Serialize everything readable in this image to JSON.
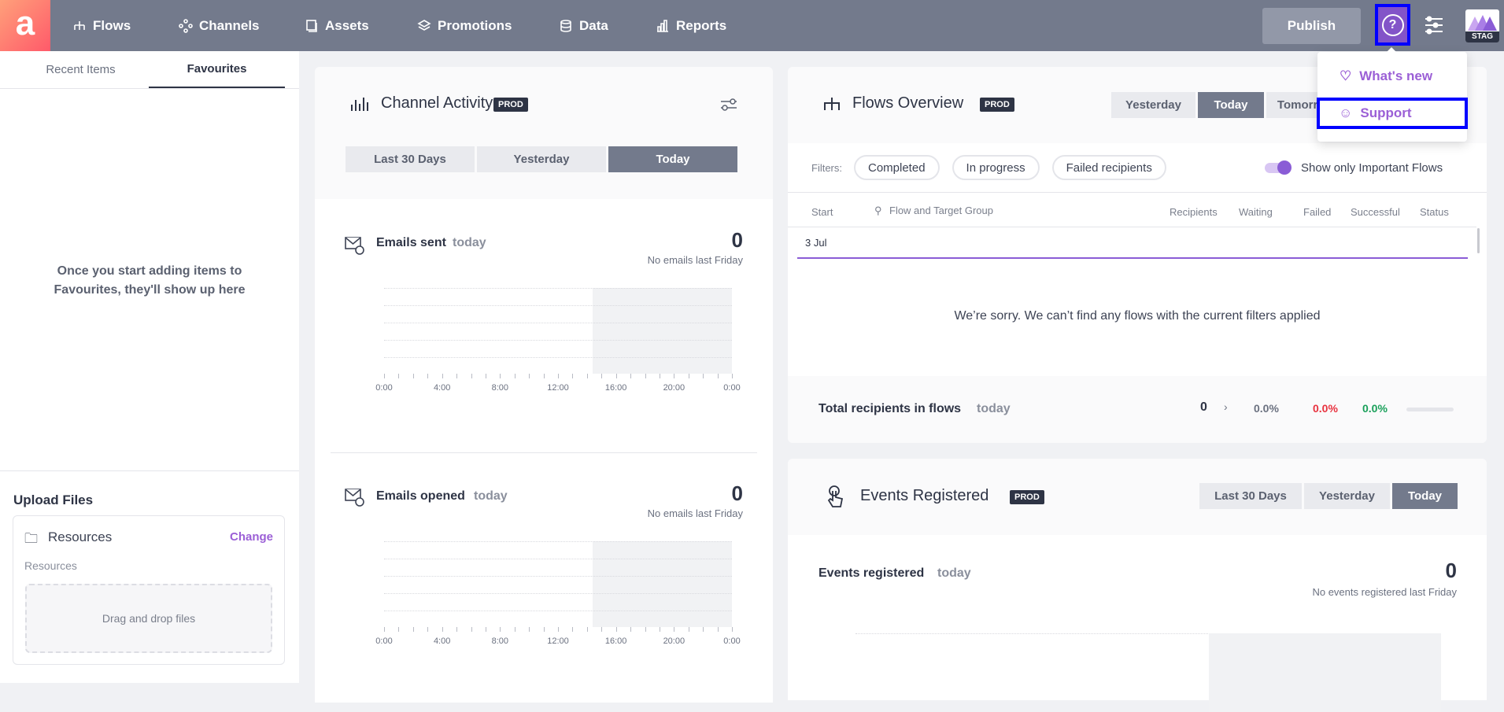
{
  "topbar": {
    "logo": "a",
    "nav": [
      {
        "label": "Flows",
        "icon": "flows-icon"
      },
      {
        "label": "Channels",
        "icon": "channels-icon"
      },
      {
        "label": "Assets",
        "icon": "assets-icon"
      },
      {
        "label": "Promotions",
        "icon": "promotions-icon"
      },
      {
        "label": "Data",
        "icon": "database-icon"
      },
      {
        "label": "Reports",
        "icon": "reports-icon"
      }
    ],
    "publish": "Publish",
    "help": "?",
    "env": "STAG"
  },
  "help_menu": {
    "items": [
      {
        "label": "What's new",
        "icon": "heart-icon"
      },
      {
        "label": "Support",
        "icon": "smiley-icon"
      }
    ]
  },
  "left": {
    "tabs": [
      "Recent Items",
      "Favourites"
    ],
    "active_tab": "Favourites",
    "empty": "Once you start adding items to Favourites, they'll show up here",
    "upload": {
      "title": "Upload Files",
      "folder": "Resources",
      "change": "Change",
      "path": "Resources",
      "drop": "Drag and drop files"
    }
  },
  "channel_activity": {
    "title": "Channel Activity",
    "badge": "PROD",
    "ranges": [
      "Last 30 Days",
      "Yesterday",
      "Today"
    ],
    "active": "Today",
    "sections": [
      {
        "title": "Emails sent",
        "period": "today",
        "value": "0",
        "compare": "No emails last Friday"
      },
      {
        "title": "Emails opened",
        "period": "today",
        "value": "0",
        "compare": "No emails last Friday"
      }
    ],
    "ticks": [
      "0:00",
      "4:00",
      "8:00",
      "12:00",
      "16:00",
      "20:00",
      "0:00"
    ]
  },
  "flows": {
    "title": "Flows Overview",
    "badge": "PROD",
    "ranges": [
      "Yesterday",
      "Today",
      "Tomorrow"
    ],
    "active": "Today",
    "filters_label": "Filters:",
    "filters": [
      "Completed",
      "In progress",
      "Failed recipients"
    ],
    "toggle_label": "Show only Important Flows",
    "toggle_on": true,
    "columns": {
      "start": "Start",
      "flow": "Flow and Target Group",
      "recipients": "Recipients",
      "waiting": "Waiting",
      "failed": "Failed",
      "successful": "Successful",
      "status": "Status"
    },
    "date_row": "3 Jul",
    "empty": "We’re sorry. We can’t find any flows with the current filters applied",
    "total": {
      "label": "Total recipients in flows",
      "period": "today",
      "count": "0",
      "waiting": "0.0%",
      "failed": "0.0%",
      "successful": "0.0%"
    },
    "colors": {
      "failed": "#e8323f",
      "successful": "#1aa05a",
      "accent": "#8a5cd6"
    }
  },
  "events": {
    "title": "Events Registered",
    "badge": "PROD",
    "ranges": [
      "Last 30 Days",
      "Yesterday",
      "Today"
    ],
    "active": "Today",
    "section": {
      "title": "Events registered",
      "period": "today",
      "value": "0",
      "compare": "No events registered last Friday"
    }
  }
}
